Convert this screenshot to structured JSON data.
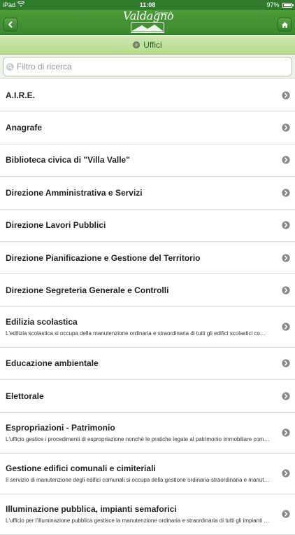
{
  "status_bar": {
    "device": "iPad",
    "time": "11:08",
    "battery": "97%"
  },
  "nav": {
    "logo_text": "Valdagno",
    "logo_prefix": "Comune di",
    "back_icon": "back-arrow-icon",
    "home_icon": "home-icon",
    "accent_color": "#3a8a2e"
  },
  "section": {
    "title": "Uffici",
    "icon": "globe-icon"
  },
  "search": {
    "placeholder": "Filtro di ricerca",
    "value": ""
  },
  "items": [
    {
      "label": "A.I.R.E.",
      "desc": ""
    },
    {
      "label": "Anagrafe",
      "desc": ""
    },
    {
      "label": "Biblioteca civica di \"Villa Valle\"",
      "desc": ""
    },
    {
      "label": "Direzione Amministrativa e Servizi",
      "desc": ""
    },
    {
      "label": "Direzione Lavori Pubblici",
      "desc": ""
    },
    {
      "label": "Direzione Pianificazione e Gestione del Territorio",
      "desc": ""
    },
    {
      "label": "Direzione Segreteria Generale e Controlli",
      "desc": ""
    },
    {
      "label": "Edilizia scolastica",
      "desc": "L'edilizia scolastica si occupa della manutenzione ordinaria e straordinaria di tutti gli edifici scolastici comunali (dalle scuole materne..."
    },
    {
      "label": "Educazione ambientale",
      "desc": ""
    },
    {
      "label": "Elettorale",
      "desc": ""
    },
    {
      "label": "Espropriazioni - Patrimonio",
      "desc": "L'ufficio gestice i procedimenti di espropriazione nonchè le pratiche legate al patrimonio immobiliare comunale."
    },
    {
      "label": "Gestione edifici comunali e cimiteriali",
      "desc": "Il servizio di manutenzione degli edifici comunali si occupa della gestione ordinaria-straordinaria e manutenzione dei fabbricati comu..."
    },
    {
      "label": "Illuminazione pubblica, impianti semaforici",
      "desc": "L'ufficio per l'illuminazione pubblica gestisce la manutenzione ordinaria e straordinaria di tutti gli impianti di illuminazione pubblica e..."
    }
  ]
}
